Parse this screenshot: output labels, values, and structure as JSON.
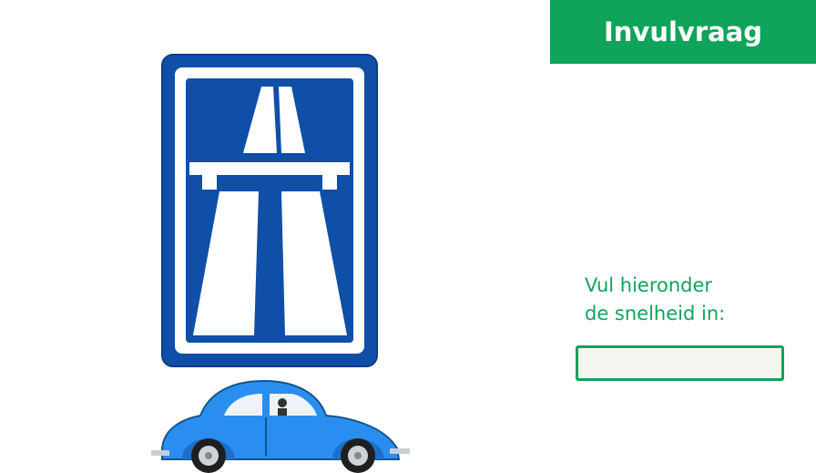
{
  "header": {
    "title": "Invulvraag",
    "color": "#10a35a"
  },
  "prompt": {
    "line1": "Vul hieronder",
    "line2": "de snelheid in:"
  },
  "answer_field": {
    "value": "",
    "placeholder": ""
  },
  "sign": {
    "icon": "motorway-sign-icon",
    "background": "#0f4fa8"
  },
  "car": {
    "icon": "blue-beetle-car-icon",
    "color": "#2a8ef0"
  }
}
